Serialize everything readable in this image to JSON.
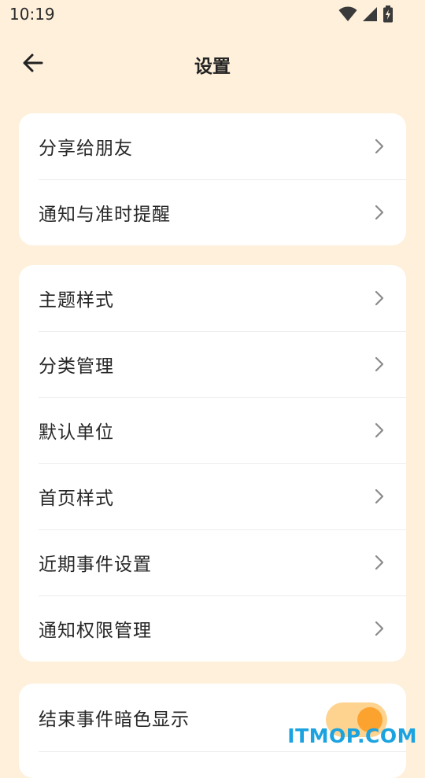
{
  "status_bar": {
    "time": "10:19",
    "icons": [
      "wifi-icon",
      "cellular-signal-icon",
      "battery-charging-icon"
    ]
  },
  "header": {
    "title": "设置",
    "back_icon": "arrow-left-icon"
  },
  "groups": [
    {
      "items": [
        {
          "label": "分享给朋友"
        },
        {
          "label": "通知与准时提醒"
        }
      ]
    },
    {
      "items": [
        {
          "label": "主题样式"
        },
        {
          "label": "分类管理"
        },
        {
          "label": "默认单位"
        },
        {
          "label": "首页样式"
        },
        {
          "label": "近期事件设置"
        },
        {
          "label": "通知权限管理"
        }
      ]
    },
    {
      "items": [
        {
          "label": "结束事件暗色显示",
          "toggle": true
        }
      ]
    }
  ],
  "watermark": "ITMOP.COM",
  "colors": {
    "background": "#FEF0DB",
    "card": "#FFFFFF",
    "toggle_track": "#FDD38F",
    "toggle_thumb": "#FBA32E",
    "watermark": "#1AA3E0"
  }
}
